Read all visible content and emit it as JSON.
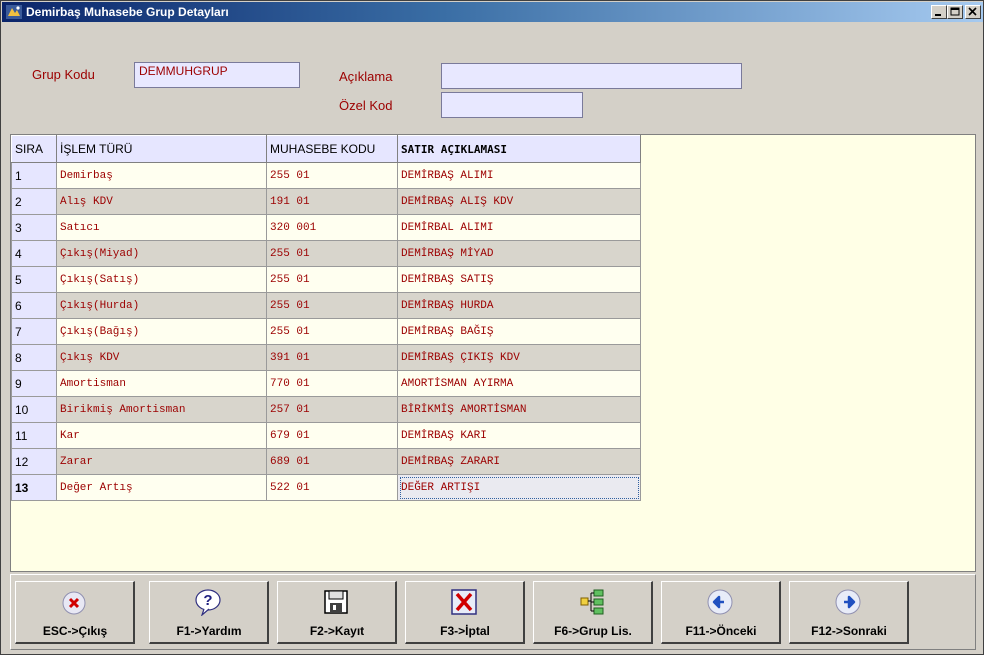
{
  "window": {
    "title": "Demirbaş Muhasebe Grup Detayları"
  },
  "header": {
    "grup_kodu_label": "Grup Kodu",
    "grup_kodu_value": "DEMMUHGRUP",
    "aciklama_label": "Açıklama",
    "aciklama_value": "",
    "ozel_kod_label": "Özel Kod",
    "ozel_kod_value": ""
  },
  "grid": {
    "columns": [
      "SIRA",
      "İŞLEM TÜRÜ",
      "MUHASEBE KODU",
      "SATIR AÇIKLAMASI"
    ],
    "rows": [
      [
        "1",
        "Demirbaş",
        "255 01",
        "DEMİRBAŞ ALIMI"
      ],
      [
        "2",
        "Alış KDV",
        "191 01",
        "DEMİRBAŞ ALIŞ KDV"
      ],
      [
        "3",
        "Satıcı",
        "320 001",
        "DEMİRBAL ALIMI"
      ],
      [
        "4",
        "Çıkış(Miyad)",
        "255 01",
        "DEMİRBAŞ MİYAD"
      ],
      [
        "5",
        "Çıkış(Satış)",
        "255 01",
        "DEMİRBAŞ SATIŞ"
      ],
      [
        "6",
        "Çıkış(Hurda)",
        "255 01",
        "DEMİRBAŞ HURDA"
      ],
      [
        "7",
        "Çıkış(Bağış)",
        "255 01",
        "DEMİRBAŞ BAĞIŞ"
      ],
      [
        "8",
        "Çıkış KDV",
        "391 01",
        "DEMİRBAŞ ÇIKIŞ KDV"
      ],
      [
        "9",
        "Amortisman",
        "770 01",
        "AMORTİSMAN AYIRMA"
      ],
      [
        "10",
        "Birikmiş Amortisman",
        "257 01",
        "BİRİKMİŞ AMORTİSMAN"
      ],
      [
        "11",
        "Kar",
        "679 01",
        "DEMİRBAŞ KARI"
      ],
      [
        "12",
        "Zarar",
        "689 01",
        "DEMİRBAŞ ZARARI"
      ],
      [
        "13",
        "Değer Artış",
        "522 01",
        "DEĞER ARTIŞI"
      ]
    ]
  },
  "toolbar": {
    "esc_label": "ESC->Çıkış",
    "help_label": "F1->Yardım",
    "save_label": "F2->Kayıt",
    "cancel_label": "F3->İptal",
    "group_list_label": "F6->Grup Lis.",
    "prev_label": "F11->Önceki",
    "next_label": "F12->Sonraki"
  },
  "colors": {
    "label_text": "#9c0000",
    "grid_background": "#ffffe6",
    "input_background": "#e8e8ff",
    "title_gradient_start": "#0a246a"
  },
  "icons": {
    "close": "close-x-icon",
    "help": "question-bubble-icon",
    "save": "floppy-disk-icon",
    "cancel": "red-x-icon",
    "group_list": "hierarchy-tree-icon",
    "prev": "arrow-left-icon",
    "next": "arrow-right-icon"
  }
}
